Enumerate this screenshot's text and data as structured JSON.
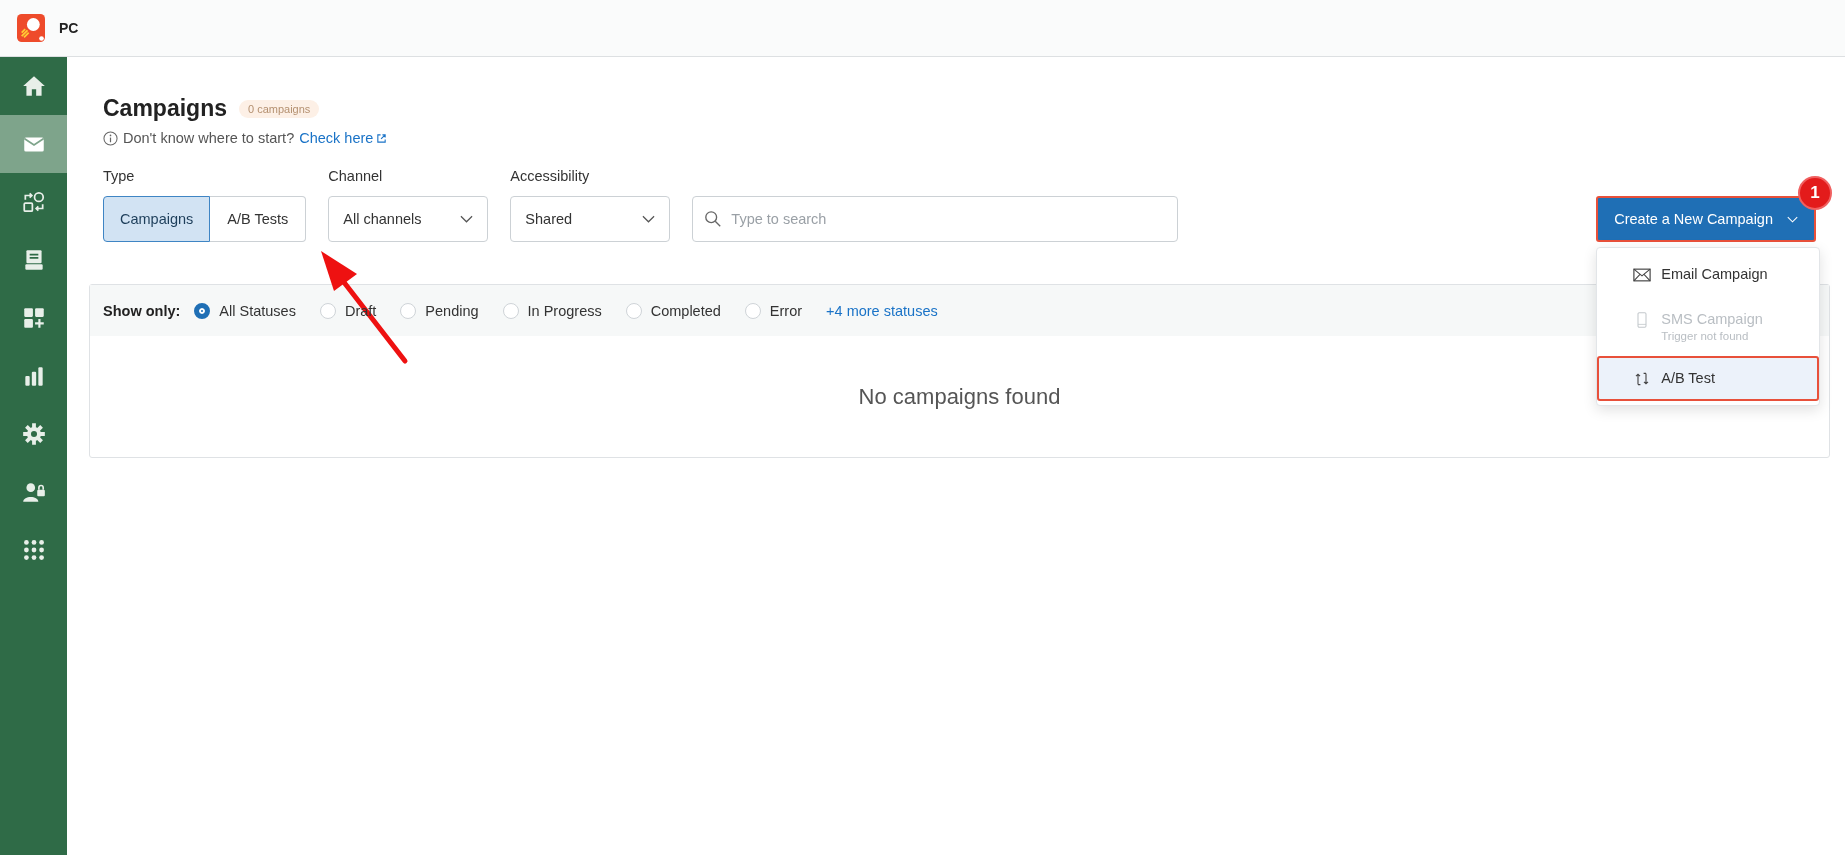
{
  "app": {
    "name": "PC"
  },
  "sidebar": {
    "items": [
      {
        "selected": false
      },
      {
        "selected": true
      },
      {
        "selected": false
      },
      {
        "selected": false
      },
      {
        "selected": false
      },
      {
        "selected": false
      },
      {
        "selected": false
      },
      {
        "selected": false
      },
      {
        "selected": false
      }
    ]
  },
  "page": {
    "title": "Campaigns",
    "count_badge": "0 campaigns",
    "hint": "Don't know where to start?",
    "hint_link": "Check here"
  },
  "filters": {
    "type": {
      "label": "Type",
      "options": [
        {
          "label": "Campaigns",
          "selected": true
        },
        {
          "label": "A/B Tests",
          "selected": false
        }
      ]
    },
    "channel": {
      "label": "Channel",
      "value": "All channels"
    },
    "accessibility": {
      "label": "Accessibility",
      "value": "Shared"
    },
    "search": {
      "placeholder": "Type to search"
    }
  },
  "create_button": {
    "label": "Create a New Campaign",
    "highlighted": true,
    "step_badge": "1"
  },
  "create_menu": [
    {
      "kind": "email",
      "label": "Email Campaign",
      "disabled": false,
      "highlighted": false
    },
    {
      "kind": "sms",
      "label": "SMS Campaign",
      "note": "Trigger not found",
      "disabled": true,
      "highlighted": false
    },
    {
      "kind": "ab",
      "label": "A/B Test",
      "disabled": false,
      "highlighted": true
    }
  ],
  "status_filter": {
    "label": "Show only:",
    "options": [
      {
        "label": "All Statuses",
        "selected": true
      },
      {
        "label": "Draft",
        "selected": false
      },
      {
        "label": "Pending",
        "selected": false
      },
      {
        "label": "In Progress",
        "selected": false
      },
      {
        "label": "Completed",
        "selected": false
      },
      {
        "label": "Error",
        "selected": false
      }
    ],
    "more_link": "+4 more statuses"
  },
  "empty_message": "No campaigns found"
}
